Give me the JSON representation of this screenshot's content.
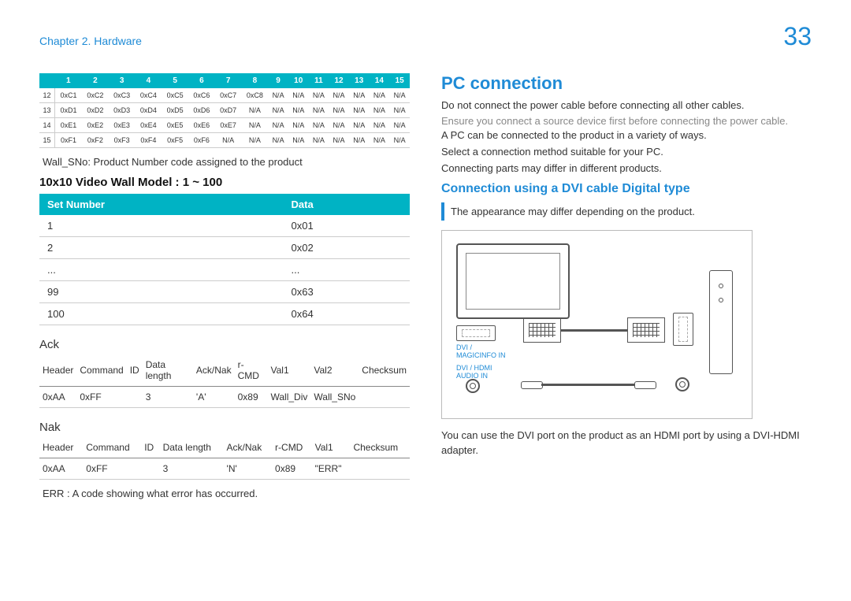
{
  "header": {
    "chapter": "Chapter 2. Hardware",
    "page_number": "33"
  },
  "hex_table": {
    "col_headers": [
      "",
      "1",
      "2",
      "3",
      "4",
      "5",
      "6",
      "7",
      "8",
      "9",
      "10",
      "11",
      "12",
      "13",
      "14",
      "15"
    ],
    "rows": [
      [
        "12",
        "0xC1",
        "0xC2",
        "0xC3",
        "0xC4",
        "0xC5",
        "0xC6",
        "0xC7",
        "0xC8",
        "N/A",
        "N/A",
        "N/A",
        "N/A",
        "N/A",
        "N/A",
        "N/A"
      ],
      [
        "13",
        "0xD1",
        "0xD2",
        "0xD3",
        "0xD4",
        "0xD5",
        "0xD6",
        "0xD7",
        "N/A",
        "N/A",
        "N/A",
        "N/A",
        "N/A",
        "N/A",
        "N/A",
        "N/A"
      ],
      [
        "14",
        "0xE1",
        "0xE2",
        "0xE3",
        "0xE4",
        "0xE5",
        "0xE6",
        "0xE7",
        "N/A",
        "N/A",
        "N/A",
        "N/A",
        "N/A",
        "N/A",
        "N/A",
        "N/A"
      ],
      [
        "15",
        "0xF1",
        "0xF2",
        "0xF3",
        "0xF4",
        "0xF5",
        "0xF6",
        "N/A",
        "N/A",
        "N/A",
        "N/A",
        "N/A",
        "N/A",
        "N/A",
        "N/A",
        "N/A"
      ]
    ]
  },
  "wall_sno_note": "Wall_SNo: Product Number code assigned to the product",
  "vw_heading": "10x10 Video Wall Model : 1 ~ 100",
  "sn_table": {
    "headers": [
      "Set Number",
      "Data"
    ],
    "rows": [
      [
        "1",
        "0x01"
      ],
      [
        "2",
        "0x02"
      ],
      [
        "...",
        "..."
      ],
      [
        "99",
        "0x63"
      ],
      [
        "100",
        "0x64"
      ]
    ]
  },
  "ack_heading": "Ack",
  "ack_table": {
    "headers": [
      "Header",
      "Command",
      "ID",
      "Data length",
      "Ack/Nak",
      "r-CMD",
      "Val1",
      "Val2",
      "Checksum"
    ],
    "row": [
      "0xAA",
      "0xFF",
      "",
      "3",
      "'A'",
      "0x89",
      "Wall_Div",
      "Wall_SNo",
      ""
    ]
  },
  "nak_heading": "Nak",
  "nak_table": {
    "headers": [
      "Header",
      "Command",
      "ID",
      "Data length",
      "Ack/Nak",
      "r-CMD",
      "Val1",
      "Checksum"
    ],
    "row": [
      "0xAA",
      "0xFF",
      "",
      "3",
      "'N'",
      "0x89",
      "\"ERR\"",
      ""
    ]
  },
  "err_note": "ERR  : A code showing what error has occurred.",
  "right": {
    "title": "PC connection",
    "p1": "Do not connect the power cable before connecting all other cables.",
    "p2": "Ensure you connect a source device first before connecting the power cable.",
    "p3": "A PC can be connected to the product in a variety of ways.",
    "p4": "Select a connection method suitable for your PC.",
    "p5": "Connecting parts may differ in different products.",
    "sub": "Connection using a DVI cable Digital type",
    "info": "The appearance may differ depending on the product.",
    "diagram": {
      "label1a": "DVI /",
      "label1b": "MAGICINFO IN",
      "label2a": "DVI / HDMI",
      "label2b": "AUDIO IN"
    },
    "p6": "You can use the DVI port on the product as an HDMI port by using a DVI-HDMI adapter."
  }
}
